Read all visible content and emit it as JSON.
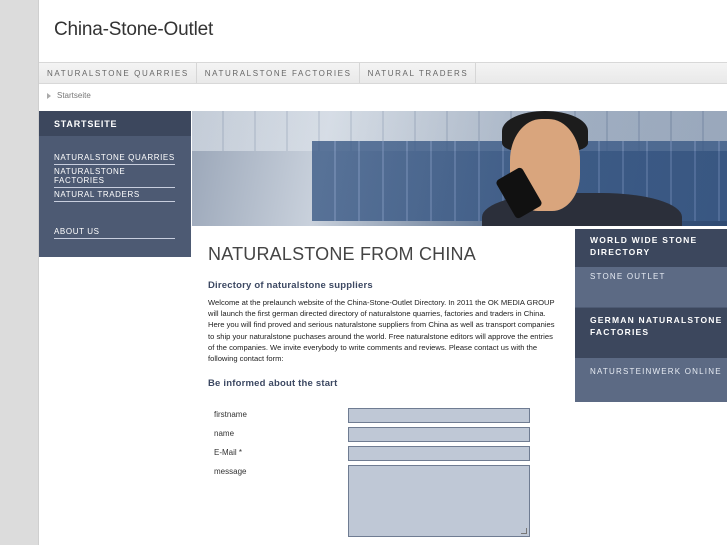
{
  "site": {
    "title": "China-Stone-Outlet"
  },
  "topnav": [
    "NATURALSTONE QUARRIES",
    "NATURALSTONE FACTORIES",
    "NATURAL TRADERS"
  ],
  "breadcrumb": "Startseite",
  "sidebar": {
    "heading": "STARTSEITE",
    "items": [
      "NATURALSTONE QUARRIES",
      "NATURALSTONE FACTORIES",
      "NATURAL TRADERS"
    ],
    "about": "ABOUT US"
  },
  "right_box": {
    "block1": "WORLD WIDE STONE DIRECTORY",
    "block2": "STONE OUTLET",
    "block3": "GERMAN NATURALSTONE FACTORIES",
    "block4": "NATURSTEINWERK ONLINE"
  },
  "main": {
    "heading": "NATURALSTONE FROM CHINA",
    "subheading": "Directory of naturalstone suppliers",
    "body": "Welcome at the prelaunch website of the China-Stone-Outlet Directory. In 2011 the OK MEDIA GROUP will launch the first german directed directory of naturalstone quarries, factories and traders in China. Here you will find proved and serious naturalstone suppliers from China as well as transport companies to ship your naturalstone puchases around the world. Free naturalstone editors will approve the entries of the companies. We invite everybody to write comments and reviews. Please contact us with the following contact form:",
    "form_heading": "Be informed about the start"
  },
  "form": {
    "firstname_label": "firstname",
    "name_label": "name",
    "email_label": "E-Mail *",
    "message_label": "message"
  },
  "colors": {
    "sidebar": "#4d5a73",
    "sidebar_dark": "#3c475d",
    "field": "#bfc8d6"
  }
}
